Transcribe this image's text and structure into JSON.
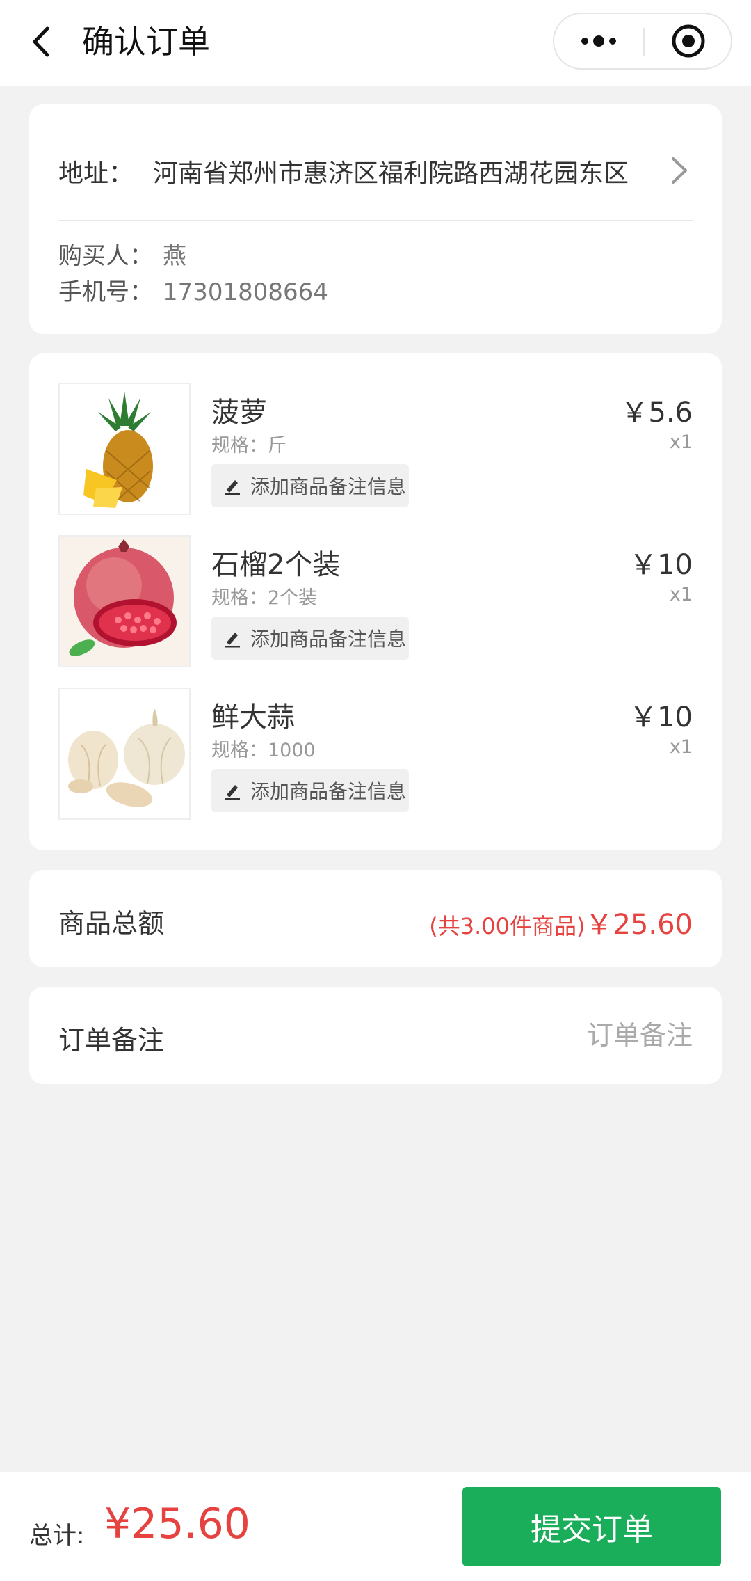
{
  "header": {
    "title": "确认订单"
  },
  "address": {
    "label": "地址：",
    "value": "河南省郑州市惠济区福利院路西湖花园东区",
    "buyer_label": "购买人：",
    "buyer_value": "燕",
    "phone_label": "手机号：",
    "phone_value": "17301808664"
  },
  "goods": [
    {
      "name": "菠萝",
      "spec": "规格：斤",
      "price": "￥5.6",
      "qty": "x1",
      "remark": "添加商品备注信息",
      "image": "pineapple"
    },
    {
      "name": "石榴2个装",
      "spec": "规格：2个装",
      "price": "￥10",
      "qty": "x1",
      "remark": "添加商品备注信息",
      "image": "pomegranate"
    },
    {
      "name": "鲜大蒜",
      "spec": "规格：1000",
      "price": "￥10",
      "qty": "x1",
      "remark": "添加商品备注信息",
      "image": "garlic"
    }
  ],
  "summary": {
    "label": "商品总额",
    "count_text": "(共3.00件商品)",
    "amount": "￥25.60"
  },
  "note": {
    "label": "订单备注",
    "placeholder": "订单备注"
  },
  "footer": {
    "total_label": "总计:",
    "total_amount": "¥25.60",
    "submit_label": "提交订单"
  },
  "colors": {
    "accent_red": "#e64340",
    "submit_green": "#1aad5a",
    "background": "#f2f2f2"
  },
  "icons": [
    "back-arrow-icon",
    "more-dots-icon",
    "close-target-icon",
    "chevron-right-icon",
    "edit-pen-icon"
  ]
}
